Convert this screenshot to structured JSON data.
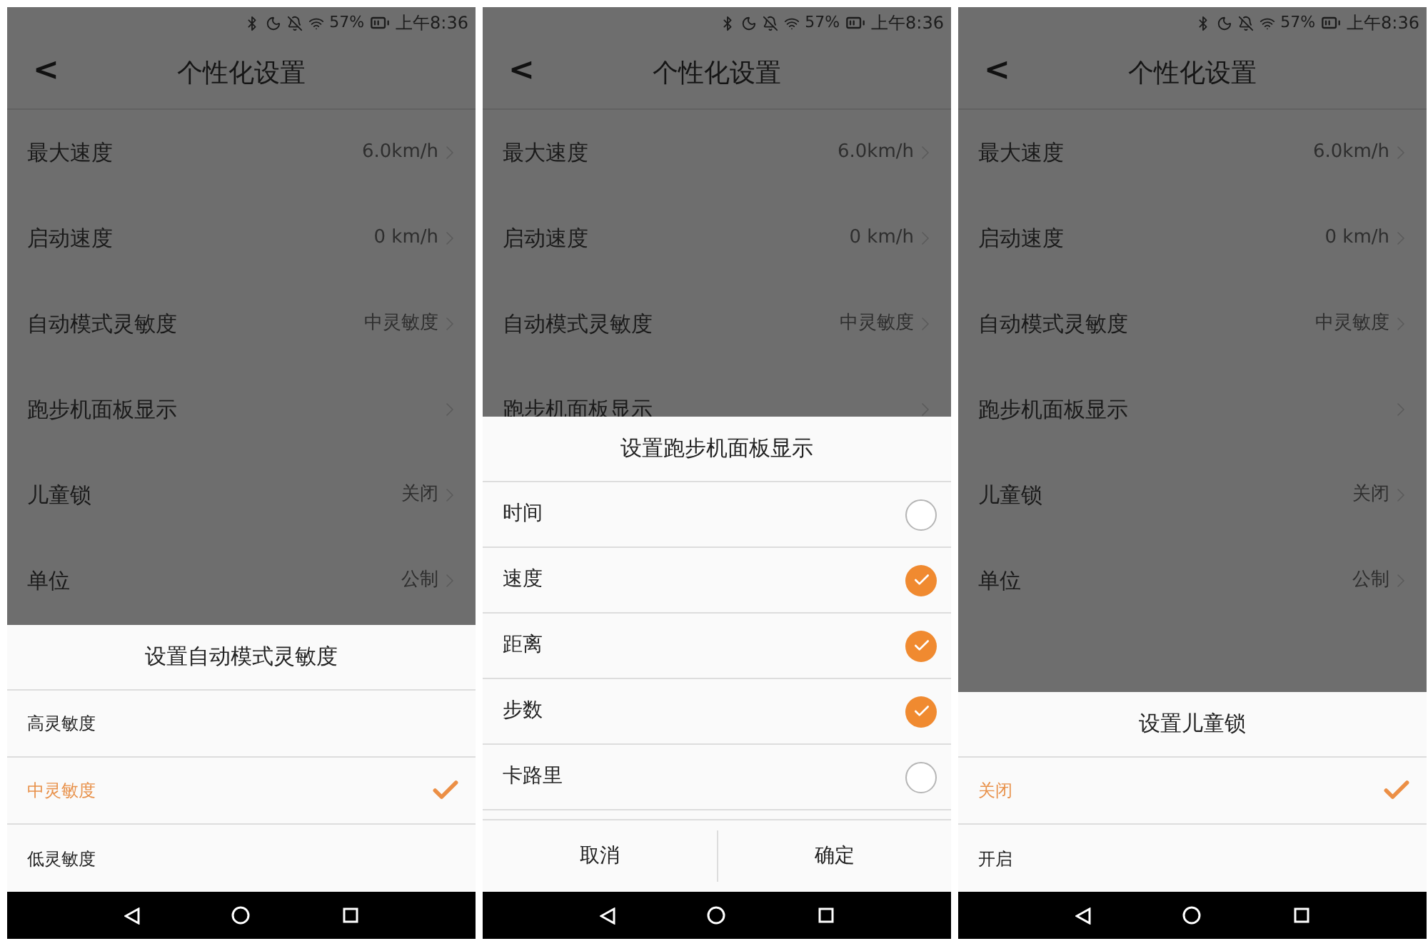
{
  "phones": [
    {
      "status": {
        "battery": "57%",
        "time": "上午8:36"
      },
      "title": "个性化设置",
      "back": "<",
      "rows": [
        {
          "label": "最大速度",
          "value": "6.0km/h"
        },
        {
          "label": "启动速度",
          "value": "0 km/h"
        },
        {
          "label": "自动模式灵敏度",
          "value": "中灵敏度"
        },
        {
          "label": "跑步机面板显示",
          "value": ""
        },
        {
          "label": "儿童锁",
          "value": "关闭"
        },
        {
          "label": "单位",
          "value": "公制"
        }
      ],
      "sheet": {
        "kind": "single",
        "title": "设置自动模式灵敏度",
        "options": [
          {
            "label": "高灵敏度",
            "selected": false
          },
          {
            "label": "中灵敏度",
            "selected": true
          },
          {
            "label": "低灵敏度",
            "selected": false
          }
        ]
      }
    },
    {
      "status": {
        "battery": "57%",
        "time": "上午8:36"
      },
      "title": "个性化设置",
      "back": "<",
      "rows": [
        {
          "label": "最大速度",
          "value": "6.0km/h"
        },
        {
          "label": "启动速度",
          "value": "0 km/h"
        },
        {
          "label": "自动模式灵敏度",
          "value": "中灵敏度"
        },
        {
          "label": "跑步机面板显示",
          "value": ""
        }
      ],
      "sheet": {
        "kind": "multi",
        "title": "设置跑步机面板显示",
        "options": [
          {
            "label": "时间",
            "checked": false
          },
          {
            "label": "速度",
            "checked": true
          },
          {
            "label": "距离",
            "checked": true
          },
          {
            "label": "步数",
            "checked": true
          },
          {
            "label": "卡路里",
            "checked": false
          }
        ],
        "buttons": [
          "取消",
          "确定"
        ]
      }
    },
    {
      "status": {
        "battery": "57%",
        "time": "上午8:36"
      },
      "title": "个性化设置",
      "back": "<",
      "rows": [
        {
          "label": "最大速度",
          "value": "6.0km/h"
        },
        {
          "label": "启动速度",
          "value": "0 km/h"
        },
        {
          "label": "自动模式灵敏度",
          "value": "中灵敏度"
        },
        {
          "label": "跑步机面板显示",
          "value": ""
        },
        {
          "label": "儿童锁",
          "value": "关闭"
        },
        {
          "label": "单位",
          "value": "公制"
        }
      ],
      "sheet": {
        "kind": "single",
        "title": "设置儿童锁",
        "options": [
          {
            "label": "关闭",
            "selected": true
          },
          {
            "label": "开启",
            "selected": false
          }
        ]
      }
    }
  ]
}
